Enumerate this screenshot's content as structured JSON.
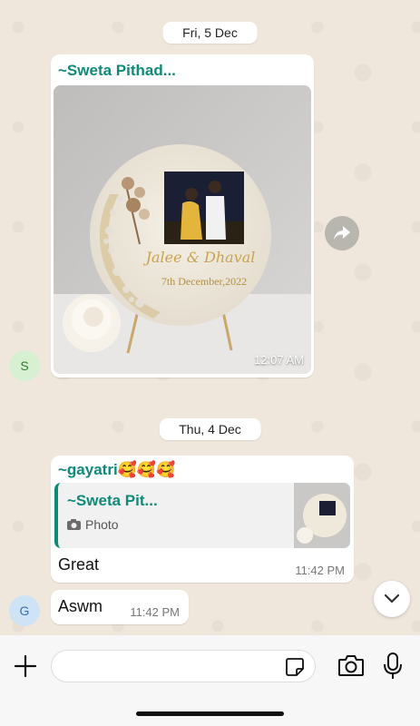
{
  "dates": {
    "first": "Fri, 5 Dec",
    "second": "Thu, 4 Dec"
  },
  "messages": [
    {
      "sender": "~Sweta Pithad...",
      "avatar_letter": "S",
      "type": "photo",
      "photo_caption_line1": "Jalee & Dhaval",
      "photo_caption_line2": "7th December,2022",
      "time": "12:07 AM"
    },
    {
      "sender": "~gayatri🥰🥰🥰",
      "type": "reply",
      "quoted_sender": "~Sweta Pit...",
      "quoted_label": "Photo",
      "text": "Great",
      "time": "11:42 PM"
    },
    {
      "avatar_letter": "G",
      "text": "Aswm",
      "time": "11:42 PM"
    }
  ],
  "input": {
    "placeholder": ""
  },
  "colors": {
    "accent": "#0f8a77",
    "wallpaper": "#efe7dc",
    "avatar_s": "#d7f0d2",
    "avatar_g": "#cfe3f7"
  },
  "icons": [
    "forward-icon",
    "chevron-down-icon",
    "plus-icon",
    "sticker-icon",
    "camera-icon",
    "microphone-icon",
    "photo-icon"
  ]
}
